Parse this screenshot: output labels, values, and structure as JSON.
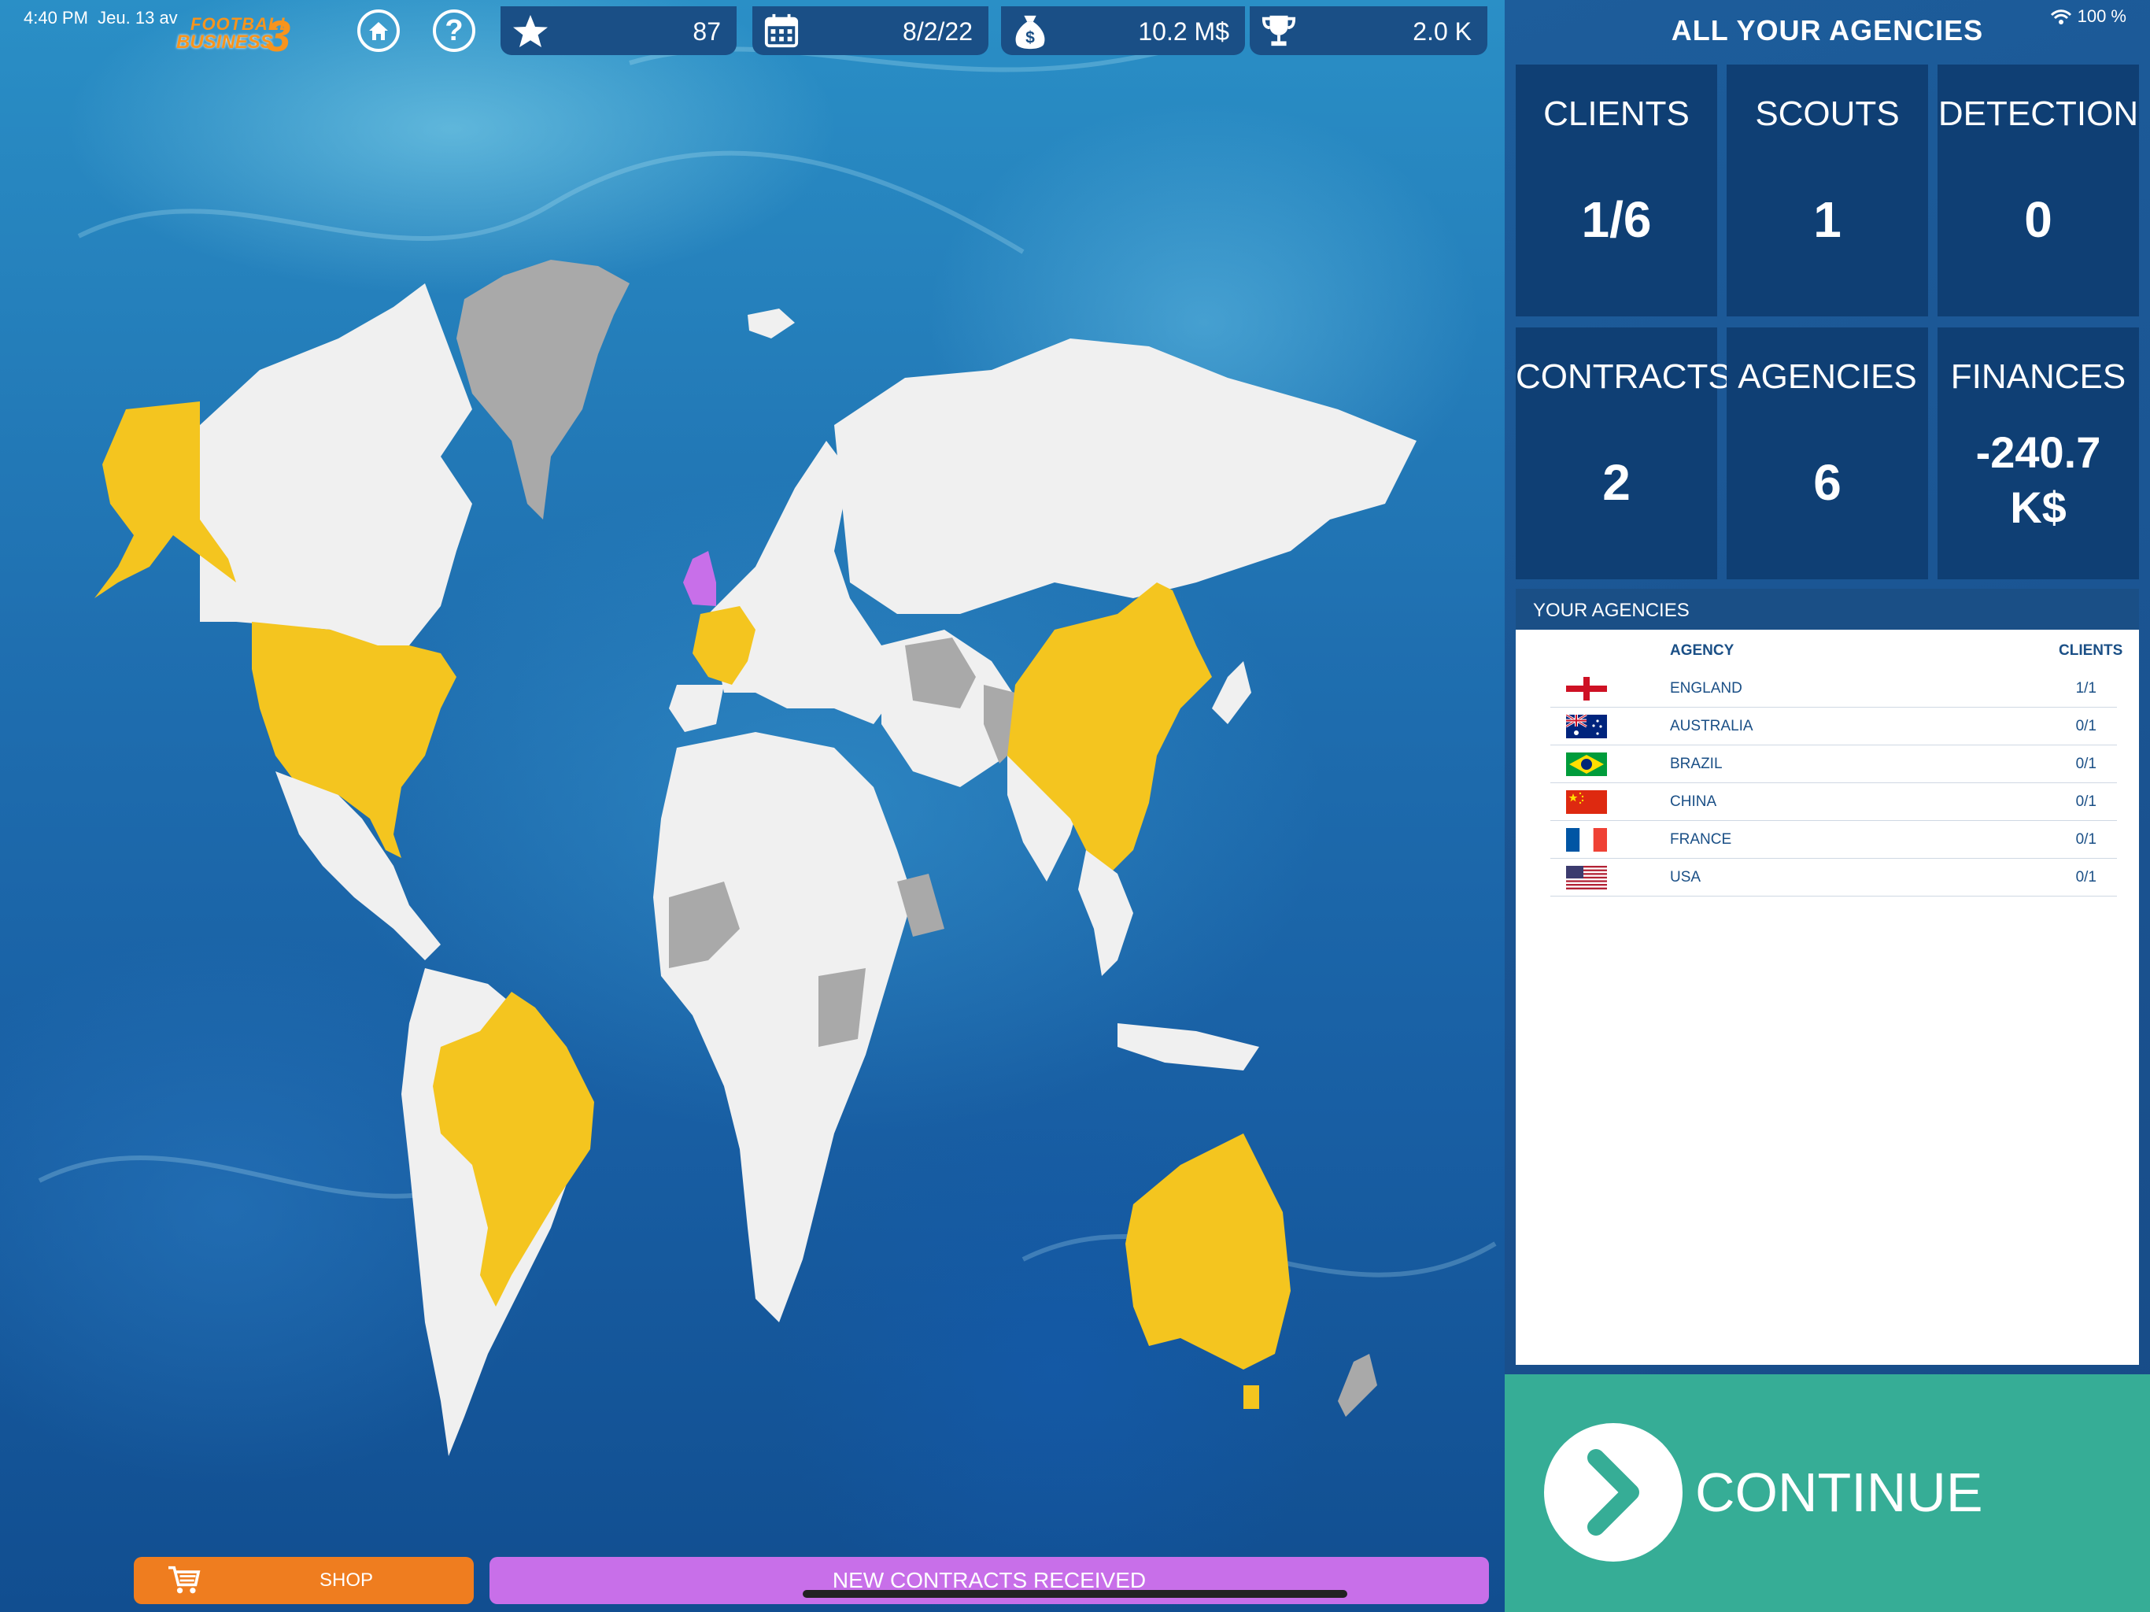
{
  "status_bar": {
    "time": "4:40 PM",
    "date": "Jeu. 13 av",
    "battery": "100 %"
  },
  "logo": {
    "line1": "FOOTBALL",
    "line2": "BUSINESS",
    "number": "3"
  },
  "top_bar": {
    "rating": "87",
    "date": "8/2/22",
    "money": "10.2 M$",
    "trophies": "2.0 K"
  },
  "bottom_bar": {
    "shop_label": "SHOP",
    "contracts_label": "NEW CONTRACTS RECEIVED"
  },
  "map": {
    "highlight_color": "#f4c51f",
    "home_color": "#c86fe9",
    "neutral_color": "#f0f0f0",
    "locked_color": "#a9a9a9"
  },
  "panel": {
    "title": "ALL YOUR AGENCIES",
    "tiles": {
      "clients": {
        "label": "CLIENTS",
        "value": "1/6"
      },
      "scouts": {
        "label": "SCOUTS",
        "value": "1"
      },
      "detection": {
        "label": "DETECTION",
        "value": "0"
      },
      "contracts": {
        "label": "CONTRACTS",
        "value": "2"
      },
      "agencies": {
        "label": "AGENCIES",
        "value": "6"
      },
      "finances": {
        "label": "FINANCES",
        "value_line1": "-240.7",
        "value_line2": "K$"
      }
    },
    "agencies_section_title": "YOUR AGENCIES",
    "table": {
      "col_agency": "AGENCY",
      "col_clients": "CLIENTS",
      "rows": [
        {
          "flag": "england-flag",
          "name": "ENGLAND",
          "clients": "1/1"
        },
        {
          "flag": "australia-flag",
          "name": "AUSTRALIA",
          "clients": "0/1"
        },
        {
          "flag": "brazil-flag",
          "name": "BRAZIL",
          "clients": "0/1"
        },
        {
          "flag": "china-flag",
          "name": "CHINA",
          "clients": "0/1"
        },
        {
          "flag": "france-flag",
          "name": "FRANCE",
          "clients": "0/1"
        },
        {
          "flag": "usa-flag",
          "name": "USA",
          "clients": "0/1"
        }
      ]
    },
    "continue_label": "CONTINUE"
  }
}
